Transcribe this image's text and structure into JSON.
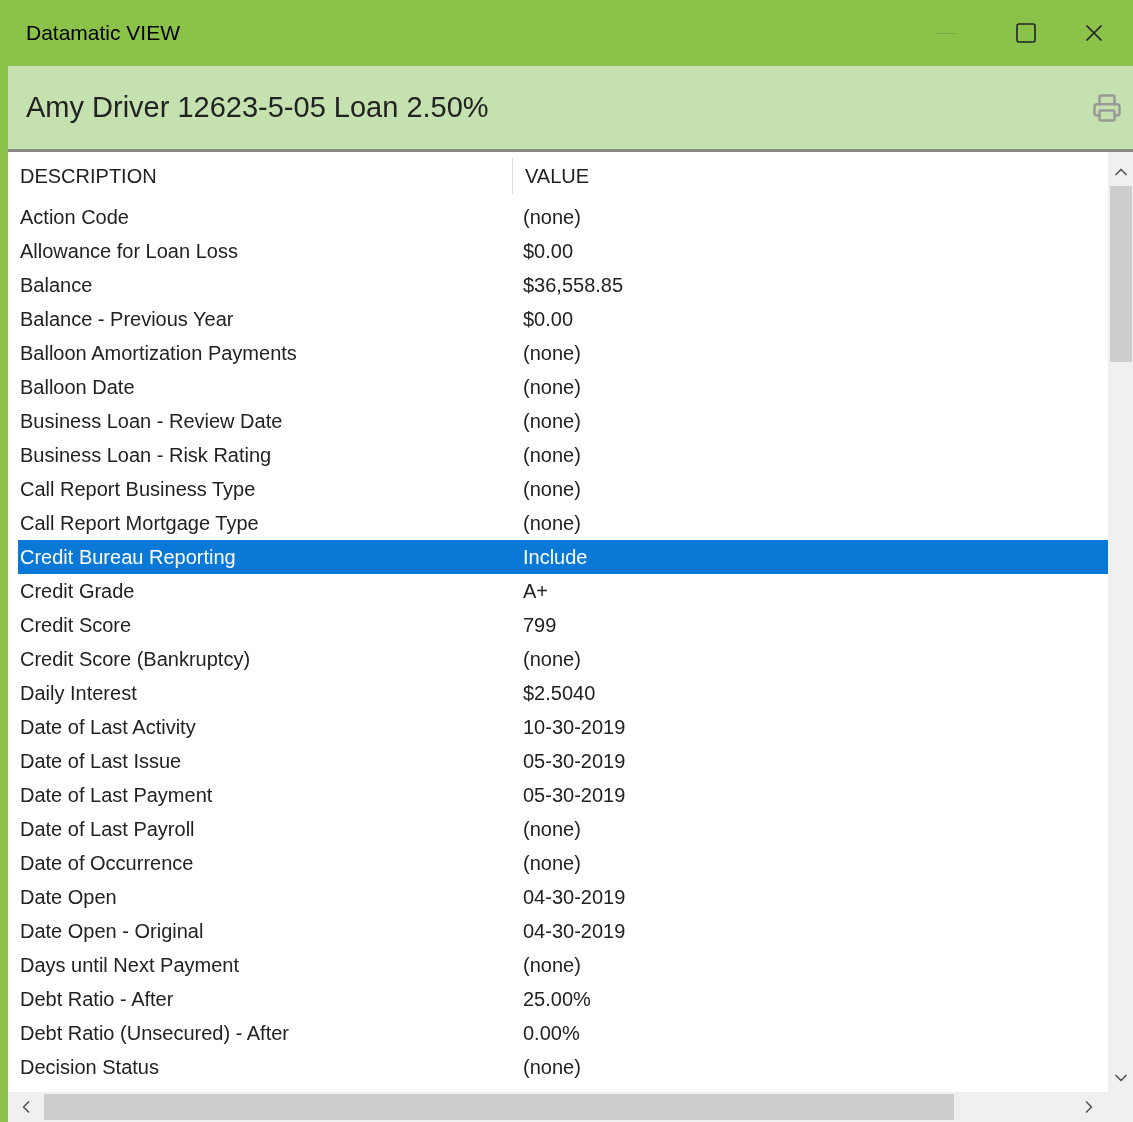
{
  "window": {
    "title": "Datamatic VIEW"
  },
  "header": {
    "title": "Amy Driver 12623-5-05 Loan 2.50%"
  },
  "table": {
    "columns": [
      "DESCRIPTION",
      "VALUE"
    ],
    "rows": [
      {
        "description": "Action Code",
        "value": "(none)",
        "selected": false
      },
      {
        "description": "Allowance for Loan Loss",
        "value": "$0.00",
        "selected": false
      },
      {
        "description": "Balance",
        "value": "$36,558.85",
        "selected": false
      },
      {
        "description": "Balance - Previous Year",
        "value": "$0.00",
        "selected": false
      },
      {
        "description": "Balloon Amortization Payments",
        "value": "(none)",
        "selected": false
      },
      {
        "description": "Balloon Date",
        "value": "(none)",
        "selected": false
      },
      {
        "description": "Business Loan - Review Date",
        "value": "(none)",
        "selected": false
      },
      {
        "description": "Business Loan - Risk Rating",
        "value": "(none)",
        "selected": false
      },
      {
        "description": "Call Report Business Type",
        "value": "(none)",
        "selected": false
      },
      {
        "description": "Call Report Mortgage Type",
        "value": "(none)",
        "selected": false
      },
      {
        "description": "Credit Bureau Reporting",
        "value": "Include",
        "selected": true
      },
      {
        "description": "Credit Grade",
        "value": "A+",
        "selected": false
      },
      {
        "description": "Credit Score",
        "value": "799",
        "selected": false
      },
      {
        "description": "Credit Score (Bankruptcy)",
        "value": "(none)",
        "selected": false
      },
      {
        "description": "Daily Interest",
        "value": "$2.5040",
        "selected": false
      },
      {
        "description": "Date of Last Activity",
        "value": "10-30-2019",
        "selected": false
      },
      {
        "description": "Date of Last Issue",
        "value": "05-30-2019",
        "selected": false
      },
      {
        "description": "Date of Last Payment",
        "value": "05-30-2019",
        "selected": false
      },
      {
        "description": "Date of Last Payroll",
        "value": "(none)",
        "selected": false
      },
      {
        "description": "Date of Occurrence",
        "value": "(none)",
        "selected": false
      },
      {
        "description": "Date Open",
        "value": "04-30-2019",
        "selected": false
      },
      {
        "description": "Date Open - Original",
        "value": "04-30-2019",
        "selected": false
      },
      {
        "description": "Days until Next Payment",
        "value": "(none)",
        "selected": false
      },
      {
        "description": "Debt Ratio - After",
        "value": "25.00%",
        "selected": false
      },
      {
        "description": "Debt Ratio (Unsecured) - After",
        "value": "0.00%",
        "selected": false
      },
      {
        "description": "Decision Status",
        "value": "(none)",
        "selected": false
      }
    ]
  }
}
